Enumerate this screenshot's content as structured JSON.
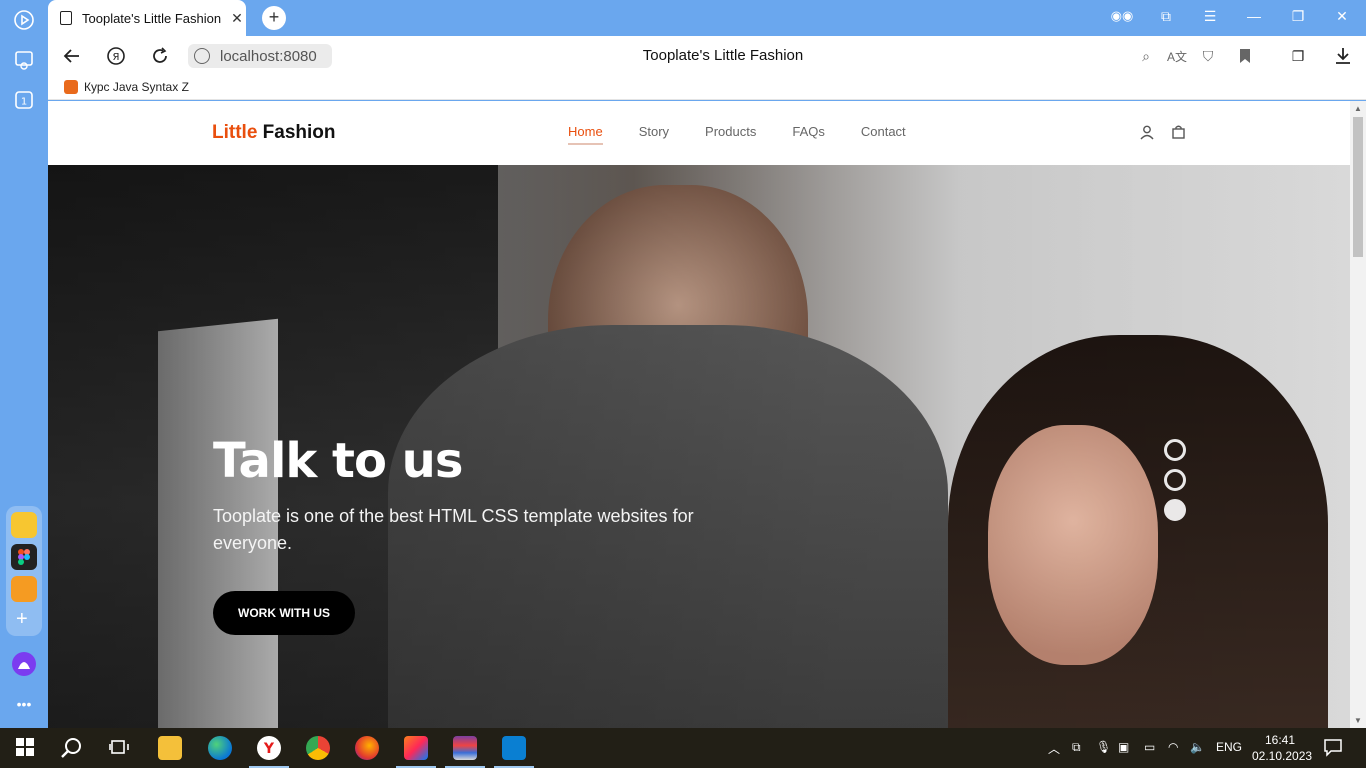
{
  "browser": {
    "tab_title": "Tooplate's Little Fashion",
    "tab_close": "✕",
    "new_tab": "+",
    "url": "localhost:8080",
    "page_title": "Tooplate's Little Fashion",
    "bookmark_label": "Курс Java Syntax Z",
    "window_controls": [
      "—",
      "❐",
      "✕"
    ]
  },
  "site": {
    "brand_accent": "Little",
    "brand_rest": " Fashion",
    "menu": [
      {
        "label": "Home",
        "active": true
      },
      {
        "label": "Story",
        "active": false
      },
      {
        "label": "Products",
        "active": false
      },
      {
        "label": "FAQs",
        "active": false
      },
      {
        "label": "Contact",
        "active": false
      }
    ],
    "hero": {
      "title": "Talk to us",
      "subtitle": "Tooplate is one of the best HTML CSS template websites for everyone.",
      "cta": "WORK WITH US",
      "slides_total": 3,
      "active_slide": 3
    }
  },
  "taskbar": {
    "lang": "ENG",
    "time": "16:41",
    "date": "02.10.2023"
  },
  "colors": {
    "accent": "#e94f0e",
    "browser_chrome": "#6aa7ee",
    "taskbar": "#221f16"
  }
}
